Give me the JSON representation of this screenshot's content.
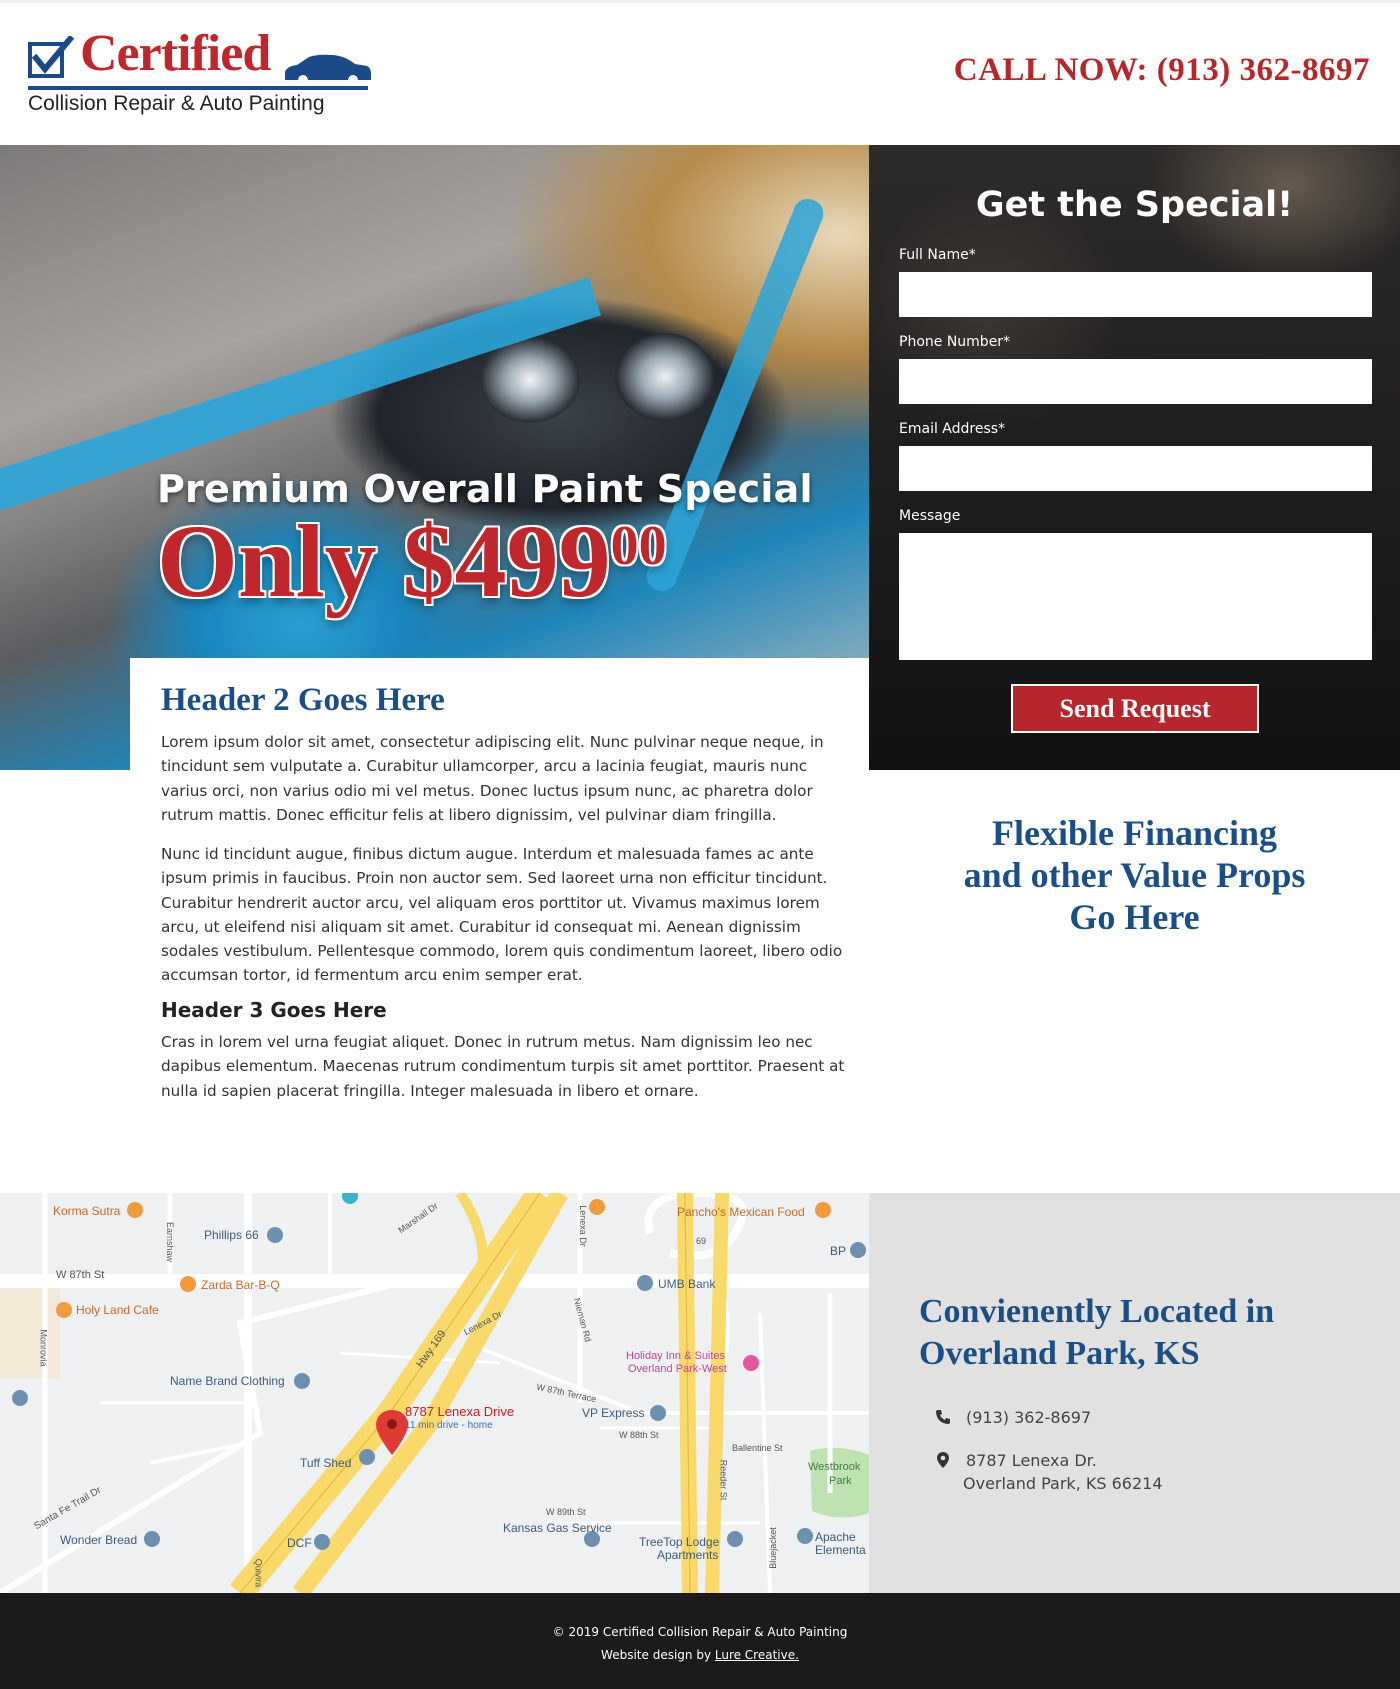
{
  "header": {
    "logo_word": "Certified",
    "logo_tagline": "Collision Repair & Auto Painting",
    "call_now": "CALL NOW: (913) 362-8697"
  },
  "hero": {
    "title": "Premium Overall Paint Special",
    "price": "Only $499",
    "price_cents": "00"
  },
  "form": {
    "title": "Get the Special!",
    "fields": [
      {
        "label": "Full Name*",
        "value": "",
        "placeholder": ""
      },
      {
        "label": "Phone Number*",
        "value": "",
        "placeholder": ""
      },
      {
        "label": "Email Address*",
        "value": "",
        "placeholder": ""
      },
      {
        "label": "Message",
        "value": "",
        "placeholder": ""
      }
    ],
    "submit_label": "Send Request"
  },
  "content": {
    "h2": "Header 2 Goes Here",
    "p1": "Lorem ipsum dolor sit amet, consectetur adipiscing elit. Nunc pulvinar neque neque, in tincidunt sem vulputate a. Curabitur ullamcorper, arcu a lacinia feugiat, mauris nunc varius orci, non varius odio mi vel metus. Donec luctus ipsum nunc, ac pharetra dolor rutrum mattis. Donec efficitur felis at libero dignissim, vel pulvinar diam fringilla.",
    "p2": "Nunc id tincidunt augue, finibus dictum augue. Interdum et malesuada fames ac ante ipsum primis in faucibus. Proin non auctor sem. Sed laoreet urna non efficitur tincidunt. Curabitur hendrerit auctor arcu, vel aliquam eros porttitor ut. Vivamus maximus lorem arcu, ut eleifend nisi aliquam sit amet. Curabitur id consequat mi. Aenean dignissim sodales vestibulum. Pellentesque commodo, lorem quis condimentum laoreet, libero odio accumsan tortor, id fermentum arcu enim semper erat.",
    "h3": "Header 3 Goes Here",
    "p3": "Cras in lorem vel urna feugiat aliquet. Donec in rutrum metus. Nam dignissim leo nec dapibus elementum. Maecenas rutrum condimentum turpis sit amet porttitor. Praesent at nulla id sapien placerat fringilla. Integer malesuada in libero et ornare."
  },
  "value_props": {
    "line1": "Flexible Financing",
    "line2": "and other Value Props",
    "line3": "Go Here"
  },
  "map": {
    "pin_label": "8787 Lenexa Drive",
    "pin_sub": "11 min drive - home",
    "labels": {
      "korma": "Korma Sutra",
      "phillips": "Phillips 66",
      "w87": "W 87th St",
      "zarda": "Zarda Bar-B-Q",
      "holyland": "Holy Land Cafe",
      "namebrand": "Name Brand Clothing",
      "hwy169": "Hwy 169",
      "lenexadr": "Lenexa Dr",
      "marshall": "Marshall Dr",
      "panchos": "Pancho's Mexican Food",
      "bp": "BP",
      "umb": "UMB Bank",
      "holidayinn1": "Holiday Inn & Suites",
      "holidayinn2": "Overland Park-West",
      "w87terrace": "W 87th Terrace",
      "vpexpress": "VP Express",
      "w88": "W 88th St",
      "ballentine": "Ballentine St",
      "westbrook1": "Westbrook",
      "westbrook2": "Park",
      "tuffshed": "Tuff Shed",
      "w89": "W 89th St",
      "kansasgas": "Kansas Gas Service",
      "treetop1": "TreeTop Lodge",
      "treetop2": "Apartments",
      "apache1": "Apache",
      "apache2": "Elementa",
      "wonderbread": "Wonder Bread",
      "dcf": "DCF",
      "santafe": "Santa Fe Trail Dr",
      "earnshaw": "Earnshaw",
      "monrovia": "Monrovia",
      "nieman": "Nieman Rd",
      "lenexadr2": "Lenexa Dr",
      "reeder": "Reeder St",
      "bluejacket": "Bluejacket",
      "quivira": "Quivira",
      "hwy69": "69"
    }
  },
  "location": {
    "title_line1": "Convienently Located in",
    "title_line2": "Overland Park, KS",
    "phone": "(913) 362-8697",
    "address1": "8787 Lenexa Dr.",
    "address2": "Overland Park, KS 66214"
  },
  "footer": {
    "copyright": "© 2019 Certified Collision Repair & Auto Painting",
    "design_prefix": "Website design by ",
    "design_link": "Lure Creative."
  },
  "colors": {
    "brand_red": "#c0272d",
    "brand_blue": "#1b4e86",
    "footer_bg": "#1c1a1a",
    "location_bg": "#e1e1e1"
  }
}
